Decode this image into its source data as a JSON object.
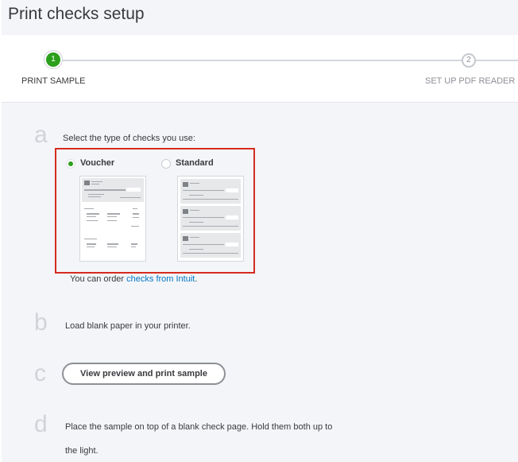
{
  "header": {
    "title": "Print checks setup"
  },
  "stepper": {
    "steps": [
      {
        "number": "1",
        "label": "PRINT SAMPLE"
      },
      {
        "number": "2",
        "label": "SET UP PDF READER"
      }
    ]
  },
  "steps": {
    "a": {
      "letter": "a",
      "text": "Select the type of checks you use:",
      "options": [
        {
          "label": "Voucher",
          "selected": true
        },
        {
          "label": "Standard",
          "selected": false
        }
      ],
      "order_prefix": "You can order ",
      "order_link": "checks from Intuit",
      "order_suffix": "."
    },
    "b": {
      "letter": "b",
      "text": "Load blank paper in your printer."
    },
    "c": {
      "letter": "c",
      "button_label": "View preview and print sample"
    },
    "d": {
      "letter": "d",
      "text_line1": "Place the sample on top of a blank check page. Hold them both up to",
      "text_line2": "the light."
    }
  },
  "colors": {
    "accent_green": "#2ca01c",
    "highlight_red": "#d52b1e",
    "link_blue": "#0077c5"
  }
}
